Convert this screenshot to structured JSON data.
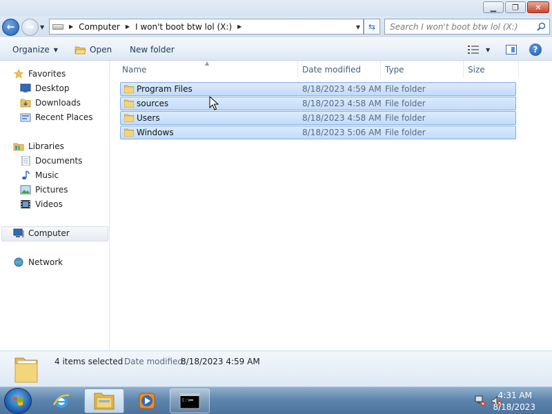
{
  "window": {
    "minimize_glyph": "▁",
    "maximize_glyph": "❐",
    "close_glyph": "✕"
  },
  "address_bar": {
    "crumbs": [
      "Computer",
      "I won't boot btw lol (X:)"
    ],
    "search_placeholder": "Search I won't boot btw lol (X:)"
  },
  "toolbar": {
    "organize_label": "Organize",
    "open_label": "Open",
    "new_folder_label": "New folder"
  },
  "nav": {
    "favorites": "Favorites",
    "desktop": "Desktop",
    "downloads": "Downloads",
    "recent_places": "Recent Places",
    "libraries": "Libraries",
    "documents": "Documents",
    "music": "Music",
    "pictures": "Pictures",
    "videos": "Videos",
    "computer": "Computer",
    "network": "Network",
    "selected": "Computer"
  },
  "columns": {
    "name": "Name",
    "date_modified": "Date modified",
    "type": "Type",
    "size": "Size"
  },
  "files": [
    {
      "name": "Program Files",
      "date": "8/18/2023 4:59 AM",
      "type": "File folder",
      "selected": true
    },
    {
      "name": "sources",
      "date": "8/18/2023 4:58 AM",
      "type": "File folder",
      "selected": true
    },
    {
      "name": "Users",
      "date": "8/18/2023 4:58 AM",
      "type": "File folder",
      "selected": true
    },
    {
      "name": "Windows",
      "date": "8/18/2023 5:06 AM",
      "type": "File folder",
      "selected": true
    }
  ],
  "details": {
    "count": "4 items selected",
    "date_label": "Date modified:",
    "date_value": "8/18/2023 4:59 AM"
  },
  "taskbar": {
    "apps": [
      "internet-explorer",
      "windows-explorer",
      "windows-media-player",
      "command-prompt"
    ],
    "active_app": "windows-explorer",
    "time": "4:31 AM",
    "date": "8/18/2023"
  },
  "colors": {
    "selection_fill": "#c9e0fb",
    "selection_border": "#84acdd",
    "accent": "#1f5fb1"
  }
}
